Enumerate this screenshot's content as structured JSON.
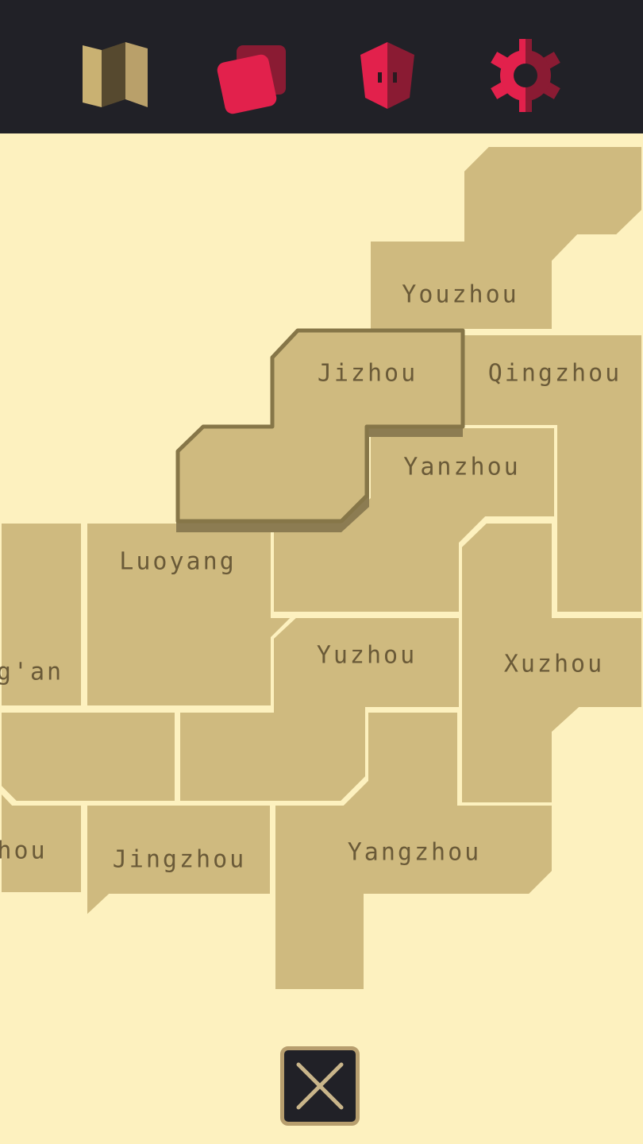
{
  "toolbar": {
    "items": [
      {
        "name": "map-icon",
        "color": "#b9a06a"
      },
      {
        "name": "cards-icon",
        "color": "#e2214c"
      },
      {
        "name": "shield-icon",
        "color": "#e2214c"
      },
      {
        "name": "gear-icon",
        "color": "#e2214c"
      }
    ]
  },
  "map": {
    "provinces": {
      "youzhou": "Youzhou",
      "jizhou": "Jizhou",
      "qingzhou": "Qingzhou",
      "yanzhou": "Yanzhou",
      "luoyang": "Luoyang",
      "yuzhou": "Yuzhou",
      "xuzhou": "Xuzhou",
      "changan": "g'an",
      "jingzhou": "Jingzhou",
      "yangzhou": "Yangzhou",
      "west_south": "hou"
    }
  },
  "close_button": {
    "icon": "close-icon"
  },
  "colors": {
    "background": "#fdf1bf",
    "toolbar": "#212127",
    "province": "#cfba7f",
    "selected_outline": "#867648",
    "label": "#6a5a38",
    "accent": "#e2214c"
  }
}
